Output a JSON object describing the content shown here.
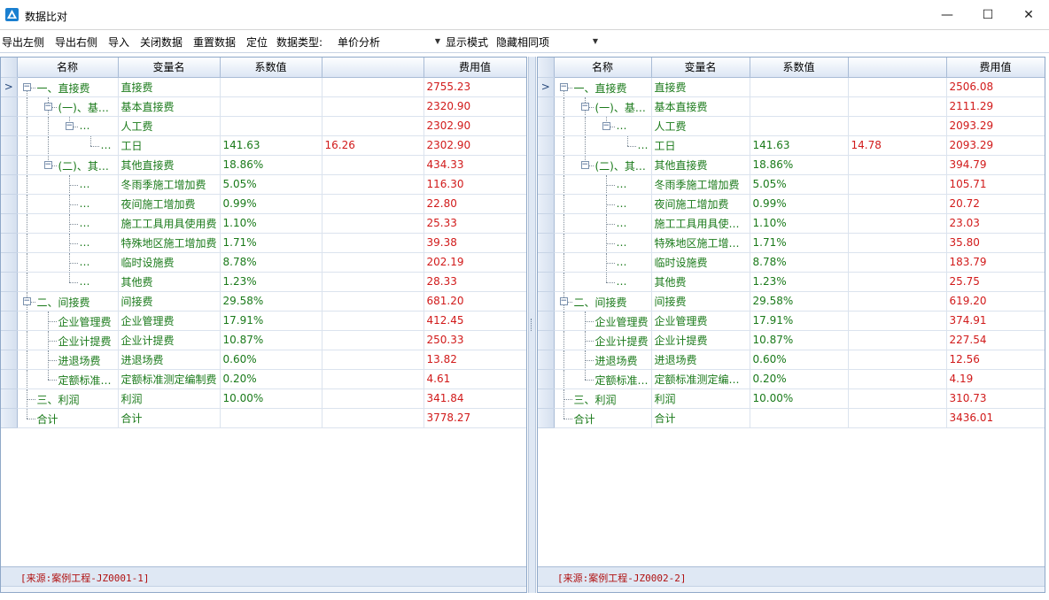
{
  "window": {
    "title": "数据比对",
    "minimize": "—",
    "maximize": "☐",
    "close": "✕"
  },
  "toolbar": {
    "export_left": "导出左侧",
    "export_right": "导出右侧",
    "import": "导入",
    "close_data": "关闭数据",
    "reset_data": "重置数据",
    "locate": "定位",
    "data_type_label": "数据类型:",
    "data_type_value": "单价分析",
    "display_mode_label": "显示模式",
    "display_mode_value": "隐藏相同项"
  },
  "columns": [
    "名称",
    "变量名",
    "系数值",
    "",
    "费用值"
  ],
  "left": {
    "source": "[来源:案例工程-JZ0001-1]",
    "rows": [
      {
        "name": "一、直接费",
        "var": "直接费",
        "coef": "",
        "extra": "",
        "cost": "2755.23"
      },
      {
        "name": "(一)、基…",
        "var": "基本直接费",
        "coef": "",
        "extra": "",
        "cost": "2320.90"
      },
      {
        "name": "…",
        "var": "人工费",
        "coef": "",
        "extra": "",
        "cost": "2302.90"
      },
      {
        "name": "…",
        "var": "工日",
        "coef": "141.63",
        "extra": "16.26",
        "cost": "2302.90"
      },
      {
        "name": "(二)、其…",
        "var": "其他直接费",
        "coef": "18.86%",
        "extra": "",
        "cost": "434.33"
      },
      {
        "name": "…",
        "var": "冬雨季施工增加费",
        "coef": "5.05%",
        "extra": "",
        "cost": "116.30"
      },
      {
        "name": "…",
        "var": "夜间施工增加费",
        "coef": "0.99%",
        "extra": "",
        "cost": "22.80"
      },
      {
        "name": "…",
        "var": "施工工具用具使用费",
        "coef": "1.10%",
        "extra": "",
        "cost": "25.33"
      },
      {
        "name": "…",
        "var": "特殊地区施工增加费",
        "coef": "1.71%",
        "extra": "",
        "cost": "39.38"
      },
      {
        "name": "…",
        "var": "临时设施费",
        "coef": "8.78%",
        "extra": "",
        "cost": "202.19"
      },
      {
        "name": "…",
        "var": "其他费",
        "coef": "1.23%",
        "extra": "",
        "cost": "28.33"
      },
      {
        "name": "二、间接费",
        "var": "间接费",
        "coef": "29.58%",
        "extra": "",
        "cost": "681.20"
      },
      {
        "name": "企业管理费",
        "var": "企业管理费",
        "coef": "17.91%",
        "extra": "",
        "cost": "412.45"
      },
      {
        "name": "企业计提费",
        "var": "企业计提费",
        "coef": "10.87%",
        "extra": "",
        "cost": "250.33"
      },
      {
        "name": "进退场费",
        "var": "进退场费",
        "coef": "0.60%",
        "extra": "",
        "cost": "13.82"
      },
      {
        "name": "定额标准…",
        "var": "定额标准测定编制费",
        "coef": "0.20%",
        "extra": "",
        "cost": "4.61"
      },
      {
        "name": "三、利润",
        "var": "利润",
        "coef": "10.00%",
        "extra": "",
        "cost": "341.84"
      },
      {
        "name": "合计",
        "var": "合计",
        "coef": "",
        "extra": "",
        "cost": "3778.27"
      }
    ]
  },
  "right": {
    "source": "[来源:案例工程-JZ0002-2]",
    "rows": [
      {
        "name": "一、直接费",
        "var": "直接费",
        "coef": "",
        "extra": "",
        "cost": "2506.08"
      },
      {
        "name": "(一)、基…",
        "var": "基本直接费",
        "coef": "",
        "extra": "",
        "cost": "2111.29"
      },
      {
        "name": "…",
        "var": "人工费",
        "coef": "",
        "extra": "",
        "cost": "2093.29"
      },
      {
        "name": "…",
        "var": "工日",
        "coef": "141.63",
        "extra": "14.78",
        "cost": "2093.29"
      },
      {
        "name": "(二)、其…",
        "var": "其他直接费",
        "coef": "18.86%",
        "extra": "",
        "cost": "394.79"
      },
      {
        "name": "…",
        "var": "冬雨季施工增加费",
        "coef": "5.05%",
        "extra": "",
        "cost": "105.71"
      },
      {
        "name": "…",
        "var": "夜间施工增加费",
        "coef": "0.99%",
        "extra": "",
        "cost": "20.72"
      },
      {
        "name": "…",
        "var": "施工工具用具使…",
        "coef": "1.10%",
        "extra": "",
        "cost": "23.03"
      },
      {
        "name": "…",
        "var": "特殊地区施工增…",
        "coef": "1.71%",
        "extra": "",
        "cost": "35.80"
      },
      {
        "name": "…",
        "var": "临时设施费",
        "coef": "8.78%",
        "extra": "",
        "cost": "183.79"
      },
      {
        "name": "…",
        "var": "其他费",
        "coef": "1.23%",
        "extra": "",
        "cost": "25.75"
      },
      {
        "name": "二、间接费",
        "var": "间接费",
        "coef": "29.58%",
        "extra": "",
        "cost": "619.20"
      },
      {
        "name": "企业管理费",
        "var": "企业管理费",
        "coef": "17.91%",
        "extra": "",
        "cost": "374.91"
      },
      {
        "name": "企业计提费",
        "var": "企业计提费",
        "coef": "10.87%",
        "extra": "",
        "cost": "227.54"
      },
      {
        "name": "进退场费",
        "var": "进退场费",
        "coef": "0.60%",
        "extra": "",
        "cost": "12.56"
      },
      {
        "name": "定额标准…",
        "var": "定额标准测定编…",
        "coef": "0.20%",
        "extra": "",
        "cost": "4.19"
      },
      {
        "name": "三、利润",
        "var": "利润",
        "coef": "10.00%",
        "extra": "",
        "cost": "310.73"
      },
      {
        "name": "合计",
        "var": "合计",
        "coef": "",
        "extra": "",
        "cost": "3436.01"
      }
    ]
  },
  "tree": {
    "levels": [
      0,
      1,
      2,
      3,
      1,
      2,
      2,
      2,
      2,
      2,
      2,
      0,
      1,
      1,
      1,
      1,
      0,
      0
    ],
    "expanders": [
      true,
      true,
      true,
      false,
      true,
      false,
      false,
      false,
      false,
      false,
      false,
      true,
      false,
      false,
      false,
      false,
      false,
      false
    ],
    "current_row": 0,
    "current_row_glyph": ">"
  },
  "colors": {
    "accent": "#0a64c8",
    "text_green": "#1a7a1a",
    "text_red": "#d11a1a",
    "source_red": "#b01010"
  }
}
